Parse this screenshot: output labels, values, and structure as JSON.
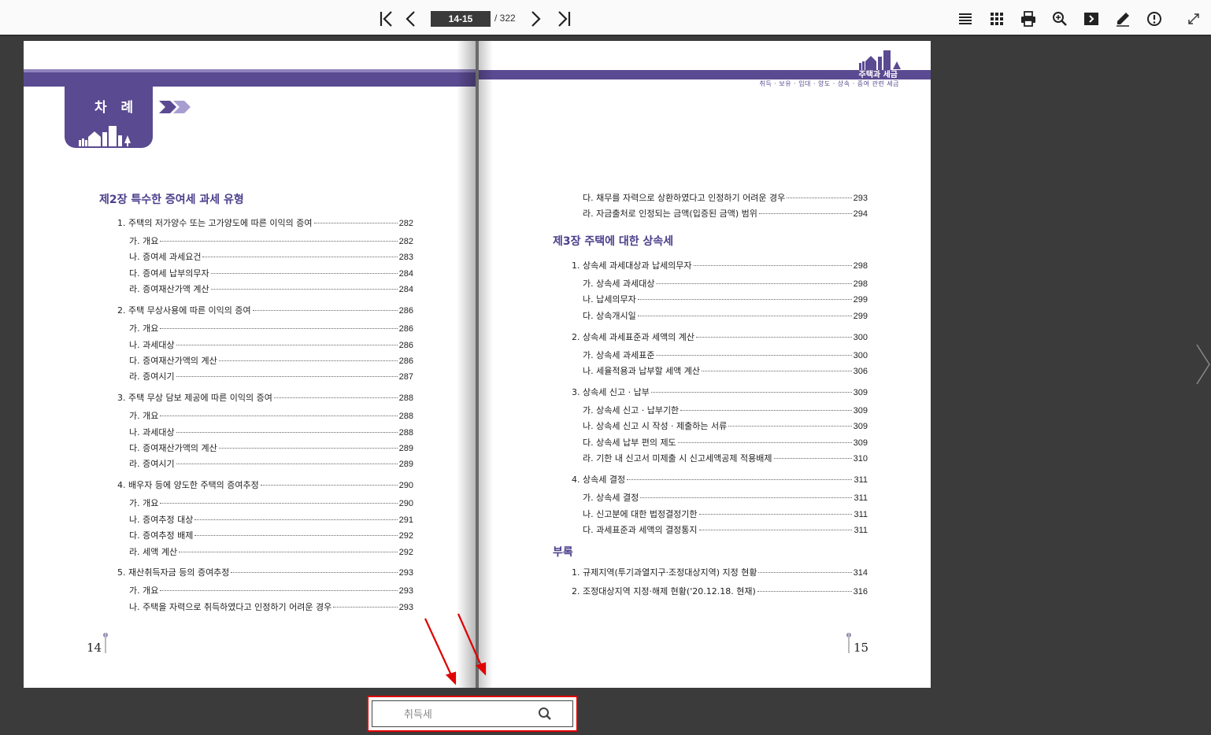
{
  "toolbar": {
    "current_page": "14-15",
    "total_pages": "/ 322",
    "left_icons": [
      "first-page-icon",
      "prev-page-icon"
    ],
    "right_icons": [
      "list-icon",
      "grid-icon",
      "print-icon",
      "zoom-icon",
      "slideshow-icon",
      "highlighter-icon",
      "info-icon",
      "fullscreen-icon"
    ]
  },
  "left_page": {
    "tab_title": "차 례",
    "page_number": "14",
    "chapter": "제2장 특수한 증여세 과세 유형",
    "entries": [
      {
        "label": "1. 주택의 저가양수 또는 고가양도에 따른 이익의 증여",
        "page": "282",
        "level": 1
      },
      {
        "label": "가. 개요",
        "page": "282",
        "level": 2
      },
      {
        "label": "나. 증여세 과세요건",
        "page": "283",
        "level": 2
      },
      {
        "label": "다. 증여세 납부의무자",
        "page": "284",
        "level": 2
      },
      {
        "label": "라. 증여재산가액 계산",
        "page": "284",
        "level": 2
      },
      {
        "label": "2. 주택 무상사용에 따른 이익의 증여",
        "page": "286",
        "level": 1
      },
      {
        "label": "가. 개요",
        "page": "286",
        "level": 2
      },
      {
        "label": "나. 과세대상",
        "page": "286",
        "level": 2
      },
      {
        "label": "다. 증여재산가액의 계산",
        "page": "286",
        "level": 2
      },
      {
        "label": "라. 증여시기",
        "page": "287",
        "level": 2
      },
      {
        "label": "3. 주택 무상 담보 제공에 따른 이익의 증여",
        "page": "288",
        "level": 1
      },
      {
        "label": "가. 개요",
        "page": "288",
        "level": 2
      },
      {
        "label": "나. 과세대상",
        "page": "288",
        "level": 2
      },
      {
        "label": "다. 증여재산가액의 계산",
        "page": "289",
        "level": 2
      },
      {
        "label": "라. 증여시기",
        "page": "289",
        "level": 2
      },
      {
        "label": "4. 배우자 등에 양도한 주택의 증여추정",
        "page": "290",
        "level": 1
      },
      {
        "label": "가. 개요",
        "page": "290",
        "level": 2
      },
      {
        "label": "나. 증여추정 대상",
        "page": "291",
        "level": 2
      },
      {
        "label": "다. 증여추정 배제",
        "page": "292",
        "level": 2
      },
      {
        "label": "라. 세액 계산",
        "page": "292",
        "level": 2
      },
      {
        "label": "5. 재산취득자금 등의 증여추정",
        "page": "293",
        "level": 1
      },
      {
        "label": "가. 개요",
        "page": "293",
        "level": 2
      },
      {
        "label": "나. 주택을 자력으로 취득하였다고 인정하기 어려운 경우",
        "page": "293",
        "level": 2
      }
    ]
  },
  "right_page": {
    "brand_title": "주택과 세금",
    "brand_subtitle": "취득 · 보유 · 임대 · 양도 · 상속 · 증여 관련 세금",
    "page_number": "15",
    "pre_entries": [
      {
        "label": "다. 채무를 자력으로 상환하였다고 인정하기 어려운 경우",
        "page": "293",
        "level": 2
      },
      {
        "label": "라. 자금출처로 인정되는 금액(입증된 금액) 범위",
        "page": "294",
        "level": 2
      }
    ],
    "chapter3": "제3장 주택에 대한 상속세",
    "entries3": [
      {
        "label": "1. 상속세 과세대상과 납세의무자",
        "page": "298",
        "level": 1
      },
      {
        "label": "가. 상속세 과세대상",
        "page": "298",
        "level": 2
      },
      {
        "label": "나. 납세의무자",
        "page": "299",
        "level": 2
      },
      {
        "label": "다. 상속개시일",
        "page": "299",
        "level": 2
      },
      {
        "label": "2. 상속세 과세표준과 세액의 계산",
        "page": "300",
        "level": 1
      },
      {
        "label": "가. 상속세 과세표준",
        "page": "300",
        "level": 2
      },
      {
        "label": "나. 세율적용과 납부할 세액 계산",
        "page": "306",
        "level": 2
      },
      {
        "label": "3. 상속세 신고 · 납부",
        "page": "309",
        "level": 1
      },
      {
        "label": "가. 상속세 신고 · 납부기한",
        "page": "309",
        "level": 2
      },
      {
        "label": "나. 상속세 신고 시 작성 · 제출하는 서류",
        "page": "309",
        "level": 2
      },
      {
        "label": "다. 상속세 납부 편의 제도",
        "page": "309",
        "level": 2
      },
      {
        "label": "라. 기한 내 신고서 미제출 시 신고세액공제 적용배제",
        "page": "310",
        "level": 2
      },
      {
        "label": "4. 상속세 결정",
        "page": "311",
        "level": 1
      },
      {
        "label": "가. 상속세 결정",
        "page": "311",
        "level": 2
      },
      {
        "label": "나. 신고분에 대한 법정결정기한",
        "page": "311",
        "level": 2
      },
      {
        "label": "다. 과세표준과 세액의 결정통지",
        "page": "311",
        "level": 2
      }
    ],
    "appendix": "부록",
    "appendix_entries": [
      {
        "label": "1. 규제지역(투기과열지구·조정대상지역) 지정 현황",
        "page": "314",
        "level": 1
      },
      {
        "label": "2. 조정대상지역 지정·해제 현황('20.12.18. 현재)",
        "page": "316",
        "level": 1
      }
    ]
  },
  "search": {
    "value": "취득세",
    "placeholder": "취득세"
  },
  "colors": {
    "accent": "#5a4a91",
    "accent_light": "#8f82bd",
    "annotation": "#e00000"
  }
}
